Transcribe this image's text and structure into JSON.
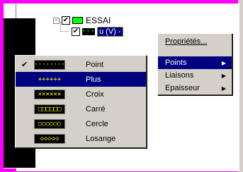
{
  "tree": {
    "root_label": "ESSAI",
    "root_expand": "−",
    "child_label": "u (V) -"
  },
  "context_menu": {
    "items": [
      {
        "label": "Propriétés..."
      },
      {
        "label": "Points"
      },
      {
        "label": "Liaisons"
      },
      {
        "label": "Epaisseur"
      }
    ],
    "arrow": "▶"
  },
  "points_menu": {
    "check_mark": "✔",
    "items": [
      {
        "label": "Point",
        "glyph": "··········",
        "checked": true
      },
      {
        "label": "Plus",
        "glyph": "++++++",
        "highlighted": true
      },
      {
        "label": "Croix",
        "glyph": "××××××"
      },
      {
        "label": "Carré",
        "glyph": "□□□□□□"
      },
      {
        "label": "Cercle",
        "glyph": "○○○○○○"
      },
      {
        "label": "Losange",
        "glyph": "◇◇◇◇◇"
      }
    ]
  },
  "colors": {
    "frame": "#ff00ff",
    "highlight": "#000080",
    "menu_bg": "#d4d0c8",
    "swatch_glyph": "#ffff00",
    "root_swatch": "#00ff00"
  },
  "icons": {
    "check": "checkbox-checked-icon",
    "root_color": "green-swatch-icon",
    "child_color": "dotted-swatch-icon",
    "submenu": "submenu-arrow-icon"
  }
}
